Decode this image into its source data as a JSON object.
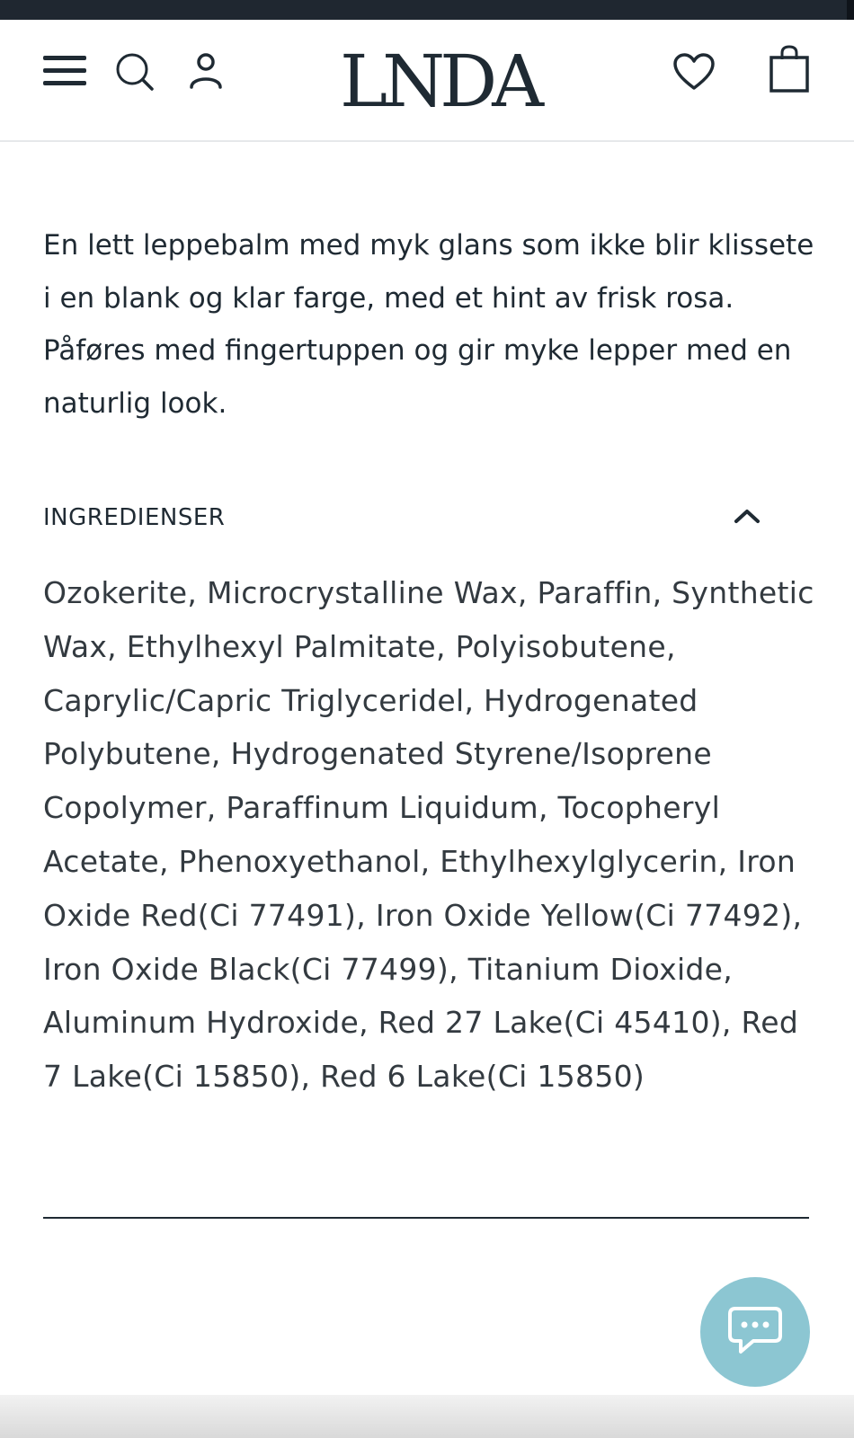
{
  "header": {
    "logo_text": "LNDA",
    "icons": [
      "menu-icon",
      "search-icon",
      "account-icon",
      "heart-icon",
      "shopping-bag-icon"
    ]
  },
  "product": {
    "description": "En lett leppebalm med myk glans som ikke blir klissete i en blank og klar farge, med et hint av frisk rosa. Påføres med fingertuppen og gir myke lepper med en naturlig look."
  },
  "accordion": {
    "title": "INGREDIENSER",
    "expanded": true,
    "ingredients": "Ozokerite, Microcrystalline Wax, Paraffin, Synthetic Wax, Ethylhexyl Palmitate, Polyisobutene, Caprylic/Capric Triglyceridel, Hydrogenated Polybutene, Hydrogenated Styrene/Isoprene Copolymer, Paraffinum Liquidum, Tocopheryl Acetate, Phenoxyethanol, Ethylhexylglycerin, Iron Oxide Red(Ci 77491), Iron Oxide Yellow(Ci 77492), Iron Oxide Black(Ci 77499), Titanium Dioxide, Aluminum Hydroxide, Red 27 Lake(Ci 45410), Red 7 Lake(Ci 15850), Red 6 Lake(Ci 15850)"
  },
  "colors": {
    "topbar": "#1f2730",
    "text": "#1f2a33",
    "chat_button": "#8cc6d2"
  }
}
